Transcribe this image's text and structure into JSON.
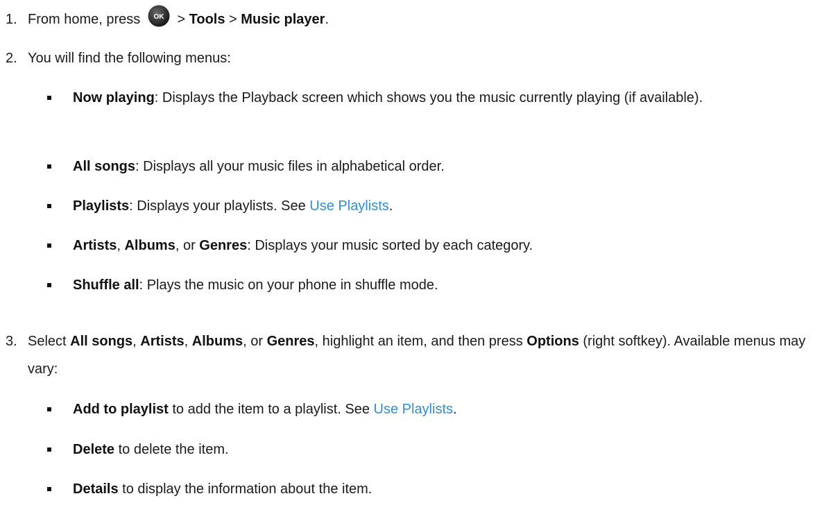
{
  "steps": [
    {
      "number": "1.",
      "prefix": "From home, press",
      "icon": "ok-button-icon",
      "icon_label": "OK",
      "sep1": " > ",
      "b1": "Tools",
      "sep2": " > ",
      "b2": "Music player",
      "suffix": "."
    },
    {
      "number": "2.",
      "text": "You will find the following menus:",
      "bullets": [
        {
          "parts": [
            {
              "b": "Now playing"
            },
            {
              "t": ": Displays the Playback screen which shows you the music currently playing (if available)."
            }
          ]
        },
        {
          "parts": [
            {
              "b": "All songs"
            },
            {
              "t": ": Displays all your music files in alphabetical order."
            }
          ]
        },
        {
          "parts": [
            {
              "b": "Playlists"
            },
            {
              "t": ": Displays your playlists. See "
            },
            {
              "link": "Use Playlists"
            },
            {
              "t": "."
            }
          ]
        },
        {
          "parts": [
            {
              "b": "Artists"
            },
            {
              "t": ", "
            },
            {
              "b": "Albums"
            },
            {
              "t": ", or "
            },
            {
              "b": "Genres"
            },
            {
              "t": ": Displays your music sorted by each category."
            }
          ]
        },
        {
          "parts": [
            {
              "b": "Shuffle all"
            },
            {
              "t": ": Plays the music on your phone in shuffle mode."
            }
          ]
        }
      ]
    },
    {
      "number": "3.",
      "parts": [
        {
          "t": "Select "
        },
        {
          "b": "All songs"
        },
        {
          "t": ", "
        },
        {
          "b": "Artists"
        },
        {
          "t": ", "
        },
        {
          "b": "Albums"
        },
        {
          "t": ", or "
        },
        {
          "b": "Genres"
        },
        {
          "t": ", highlight an item, and then press "
        },
        {
          "b": "Options"
        },
        {
          "t": " (right softkey). Available menus may vary:"
        }
      ],
      "bullets": [
        {
          "parts": [
            {
              "b": "Add to playlist"
            },
            {
              "t": " to add the item to a playlist. See "
            },
            {
              "link": "Use Playlists"
            },
            {
              "t": "."
            }
          ]
        },
        {
          "parts": [
            {
              "b": "Delete"
            },
            {
              "t": " to delete the item."
            }
          ]
        },
        {
          "parts": [
            {
              "b": "Details"
            },
            {
              "t": " to display the information about the item."
            }
          ]
        }
      ]
    }
  ],
  "colors": {
    "text": "#1a1a1a",
    "link": "#2e8fd6",
    "ok_icon": "#222222"
  }
}
